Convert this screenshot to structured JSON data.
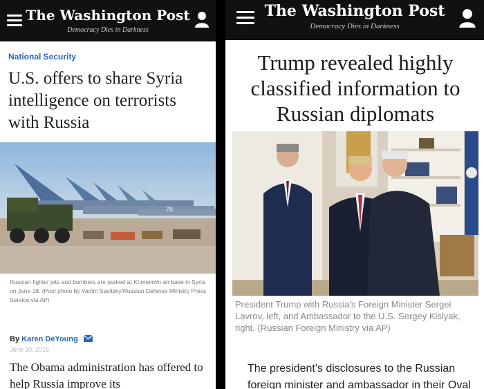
{
  "left": {
    "masthead": "The Washington Post",
    "tagline": "Democracy Dies in Darkness",
    "kicker": "National Security",
    "headline": "U.S. offers to share Syria intelligence on terrorists with Russia",
    "caption": "Russian fighter jets and bombers are parked at Khmeimim air base in Syria on June 18. (Pool photo by Vadim Savitsky/Russian Defense Ministry Press Service via AP)",
    "byline_prefix": "By",
    "byline_author": "Karen DeYoung",
    "date": "June 30, 2016",
    "body": "The Obama administration has offered to help Russia improve its",
    "photo_label": "78"
  },
  "right": {
    "masthead": "The Washington Post",
    "tagline": "Democracy Dies in Darkness",
    "headline": "Trump revealed highly classified information to Russian diplomats",
    "caption": "President Trump with Russia's Foreign Minister Sergei Lavrov, left, and Ambassador to the U.S. Sergey Kislyak, right. (Russian Foreign Ministry via AP)",
    "body": "The president's disclosures to the Russian foreign minister and ambassador in their Oval"
  },
  "icons": {
    "menu": "hamburger-menu-icon",
    "account": "user-account-icon",
    "email": "envelope-icon"
  },
  "colors": {
    "header_bg": "#111111",
    "link_blue": "#2a66b5"
  }
}
